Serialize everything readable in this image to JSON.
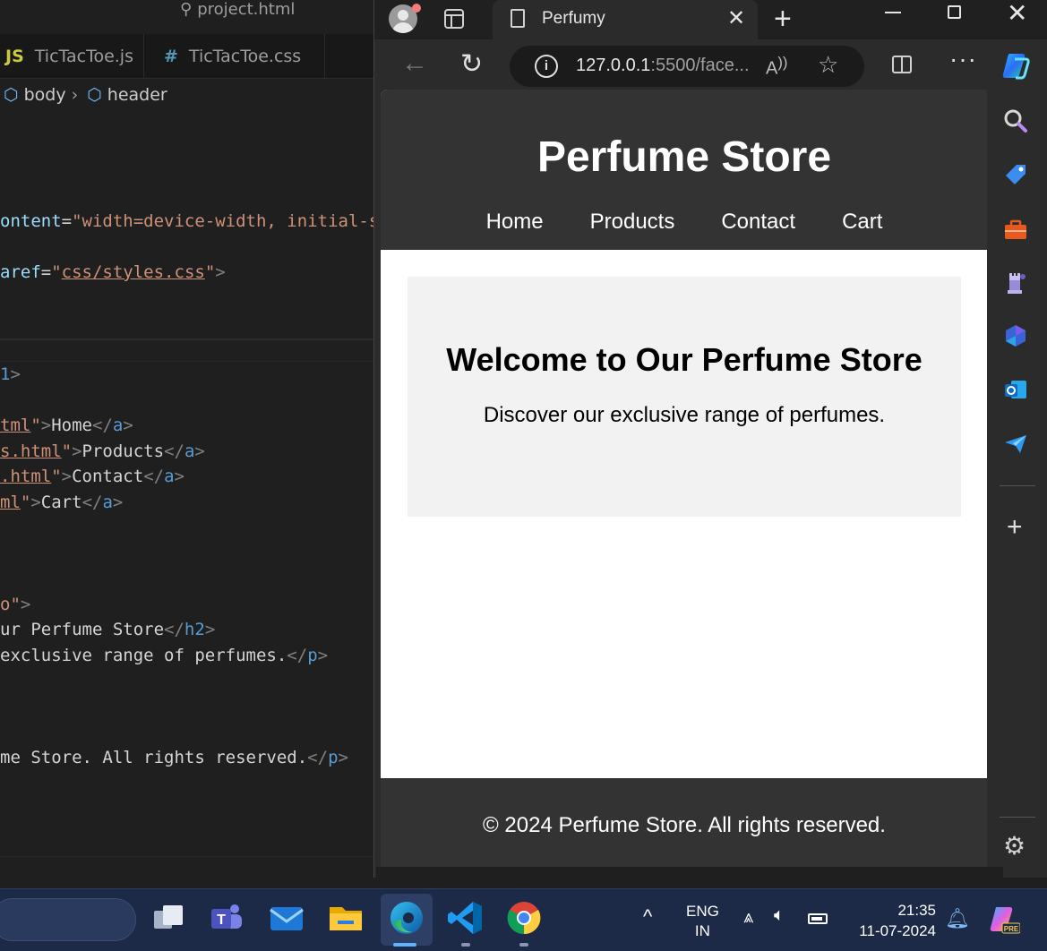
{
  "vscode": {
    "search_label": "project.html",
    "tabs": [
      {
        "icon": "JS",
        "label": "TicTacToe.js"
      },
      {
        "icon": "#",
        "label": "TicTacToe.css"
      }
    ],
    "breadcrumb": [
      "body",
      "header"
    ],
    "code_top": [
      {
        "parts": [
          [
            "c-attr",
            "ontent"
          ],
          [
            "c-text",
            "="
          ],
          [
            "c-str",
            "\"width=device-width, initial-s"
          ]
        ]
      },
      {
        "parts": [
          [
            "c-attr",
            "aref"
          ],
          [
            "c-text",
            "="
          ],
          [
            "c-str",
            "\""
          ],
          [
            "c-str c-link",
            "css/styles.css"
          ],
          [
            "c-str",
            "\""
          ],
          [
            "c-punc",
            ">"
          ]
        ]
      }
    ],
    "code_bottom": [
      {
        "parts": [
          [
            "c-tag",
            "1"
          ],
          [
            "c-punc",
            ">"
          ]
        ]
      },
      {
        "parts": [
          [
            "c-str c-link",
            "tml"
          ],
          [
            "c-str",
            "\""
          ],
          [
            "c-punc",
            ">"
          ],
          [
            "c-text",
            "Home"
          ],
          [
            "c-punc",
            "</"
          ],
          [
            "c-tag",
            "a"
          ],
          [
            "c-punc",
            ">"
          ]
        ]
      },
      {
        "parts": [
          [
            "c-str c-link",
            "s.html"
          ],
          [
            "c-str",
            "\""
          ],
          [
            "c-punc",
            ">"
          ],
          [
            "c-text",
            "Products"
          ],
          [
            "c-punc",
            "</"
          ],
          [
            "c-tag",
            "a"
          ],
          [
            "c-punc",
            ">"
          ]
        ]
      },
      {
        "parts": [
          [
            "c-str c-link",
            ".html"
          ],
          [
            "c-str",
            "\""
          ],
          [
            "c-punc",
            ">"
          ],
          [
            "c-text",
            "Contact"
          ],
          [
            "c-punc",
            "</"
          ],
          [
            "c-tag",
            "a"
          ],
          [
            "c-punc",
            ">"
          ]
        ]
      },
      {
        "parts": [
          [
            "c-str c-link",
            "ml"
          ],
          [
            "c-str",
            "\""
          ],
          [
            "c-punc",
            ">"
          ],
          [
            "c-text",
            "Cart"
          ],
          [
            "c-punc",
            "</"
          ],
          [
            "c-tag",
            "a"
          ],
          [
            "c-punc",
            ">"
          ]
        ]
      },
      {
        "parts": [
          [
            "c-str",
            "o\""
          ],
          [
            "c-punc",
            ">"
          ]
        ]
      },
      {
        "parts": [
          [
            "c-text",
            "ur Perfume Store"
          ],
          [
            "c-punc",
            "</"
          ],
          [
            "c-tag",
            "h2"
          ],
          [
            "c-punc",
            ">"
          ]
        ]
      },
      {
        "parts": [
          [
            "c-text",
            "exclusive range of perfumes."
          ],
          [
            "c-punc",
            "</"
          ],
          [
            "c-tag",
            "p"
          ],
          [
            "c-punc",
            ">"
          ]
        ]
      },
      {
        "parts": [
          [
            "c-text",
            "me Store. All rights reserved."
          ],
          [
            "c-punc",
            "</"
          ],
          [
            "c-tag",
            "p"
          ],
          [
            "c-punc",
            ">"
          ]
        ]
      }
    ]
  },
  "browser": {
    "tab_title": "Perfumy",
    "url_host": "127.0.0.1",
    "url_rest": ":5500/face...",
    "read_aloud_label": "A",
    "colors": {
      "frame": "#202020",
      "toolbar": "#2b2b2b",
      "site_header": "#333333",
      "hero_bg": "#f2f2f2"
    }
  },
  "site": {
    "title": "Perfume Store",
    "nav": [
      "Home",
      "Products",
      "Contact",
      "Cart"
    ],
    "hero_title": "Welcome to Our Perfume Store",
    "hero_text": "Discover our exclusive range of perfumes.",
    "footer": "© 2024 Perfume Store. All rights reserved."
  },
  "sidebar_icons": [
    "search-icon",
    "shopping-tag-icon",
    "tools-icon",
    "games-icon",
    "copilot-icon",
    "outlook-icon",
    "send-icon",
    "add-icon",
    "settings-icon"
  ],
  "taskbar": {
    "apps": [
      "task-view-icon",
      "teams-icon",
      "mail-icon",
      "file-explorer-icon",
      "edge-icon",
      "vscode-icon",
      "chrome-icon"
    ],
    "lang_line1": "ENG",
    "lang_line2": "IN",
    "time": "21:35",
    "date": "11-07-2024",
    "copilot_badge": "PRE"
  }
}
